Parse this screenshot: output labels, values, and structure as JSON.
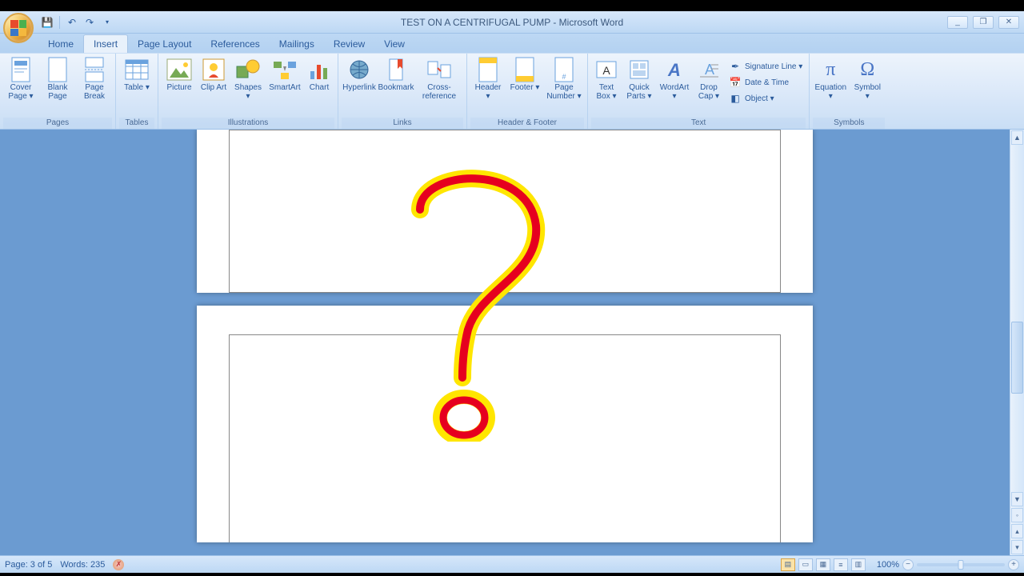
{
  "window": {
    "title": "TEST ON A CENTRIFUGAL PUMP - Microsoft Word",
    "minimize": "_",
    "maximize": "❐",
    "close": "✕"
  },
  "tabs": {
    "home": "Home",
    "insert": "Insert",
    "page_layout": "Page Layout",
    "references": "References",
    "mailings": "Mailings",
    "review": "Review",
    "view": "View"
  },
  "ribbon": {
    "pages": {
      "label": "Pages",
      "cover_page": "Cover Page ▾",
      "blank_page": "Blank Page",
      "page_break": "Page Break"
    },
    "tables": {
      "label": "Tables",
      "table": "Table ▾"
    },
    "illustrations": {
      "label": "Illustrations",
      "picture": "Picture",
      "clip_art": "Clip Art",
      "shapes": "Shapes ▾",
      "smartart": "SmartArt",
      "chart": "Chart"
    },
    "links": {
      "label": "Links",
      "hyperlink": "Hyperlink",
      "bookmark": "Bookmark",
      "cross_reference": "Cross-reference"
    },
    "header_footer": {
      "label": "Header & Footer",
      "header": "Header ▾",
      "footer": "Footer ▾",
      "page_number": "Page Number ▾"
    },
    "text": {
      "label": "Text",
      "text_box": "Text Box ▾",
      "quick_parts": "Quick Parts ▾",
      "wordart": "WordArt ▾",
      "drop_cap": "Drop Cap ▾",
      "signature_line": "Signature Line ▾",
      "date_time": "Date & Time",
      "object": "Object ▾"
    },
    "symbols": {
      "label": "Symbols",
      "equation": "Equation ▾",
      "symbol": "Symbol ▾"
    }
  },
  "statusbar": {
    "page": "Page: 3 of 5",
    "words": "Words: 235",
    "zoom_pct": "100%"
  }
}
